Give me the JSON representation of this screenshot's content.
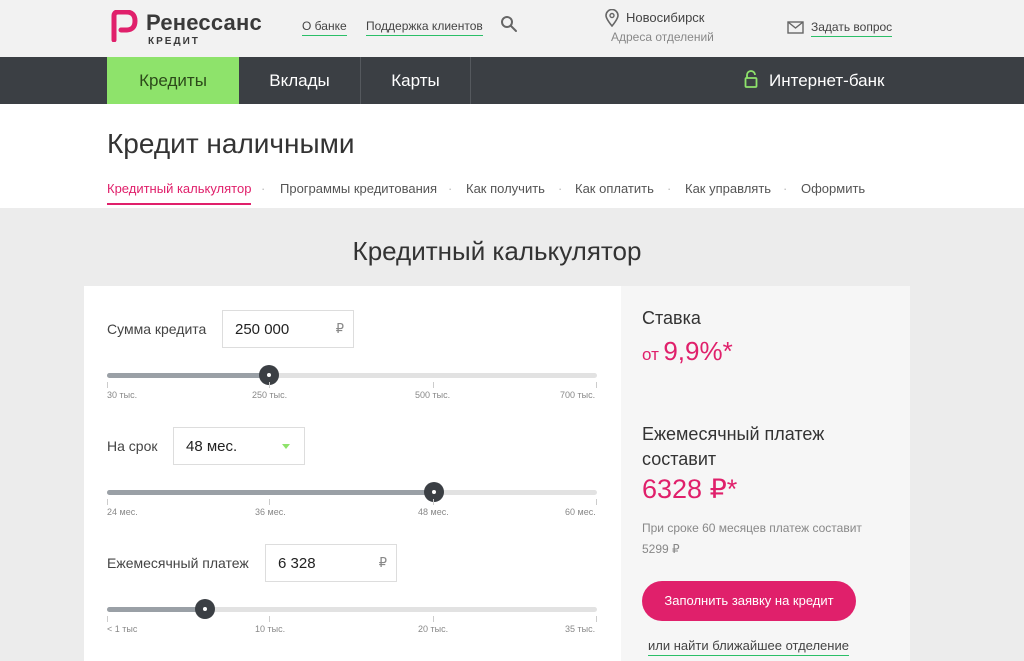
{
  "brand": {
    "name": "Ренессанс",
    "sub": "КРЕДИТ",
    "accent": "#e0206b",
    "green": "#8ee36b"
  },
  "topbar": {
    "about": "О банке",
    "support": "Поддержка клиентов",
    "city": "Новосибирск",
    "branches": "Адреса отделений",
    "ask": "Задать вопрос"
  },
  "nav": {
    "items": [
      "Кредиты",
      "Вклады",
      "Карты"
    ],
    "active": "Кредиты",
    "internet_bank": "Интернет-банк"
  },
  "page": {
    "title": "Кредит наличными",
    "subnav": [
      "Кредитный калькулятор",
      "Программы кредитования",
      "Как получить",
      "Как оплатить",
      "Как управлять",
      "Оформить"
    ],
    "subnav_active": "Кредитный калькулятор"
  },
  "calculator": {
    "title": "Кредитный калькулятор",
    "amount": {
      "label": "Сумма кредита",
      "value": "250 000",
      "unit": "₽",
      "level": 0.33,
      "ticks": [
        "30 тыс.",
        "250 тыс.",
        "500 тыс.",
        "700 тыс."
      ]
    },
    "term": {
      "label": "На срок",
      "value": "48 мес.",
      "level": 0.667,
      "ticks": [
        "24 мес.",
        "36 мес.",
        "48 мес.",
        "60 мес."
      ]
    },
    "payment": {
      "label": "Ежемесячный платеж",
      "value": "6 328",
      "unit": "₽",
      "level": 0.2,
      "ticks": [
        "< 1 тыс",
        "10 тыс.",
        "20 тыс.",
        "35 тыс."
      ]
    }
  },
  "result": {
    "rate_title": "Ставка",
    "rate_prefix": "от",
    "rate_value": "9,9%*",
    "payment_title": "Ежемесячный платеж составит",
    "payment_value": "6328 ₽*",
    "note_line1": "При сроке 60 месяцев платеж составит",
    "note_line2": "5299 ₽",
    "apply_button": "Заполнить заявку на кредит",
    "find_branch": "или найти ближайшее отделение"
  }
}
